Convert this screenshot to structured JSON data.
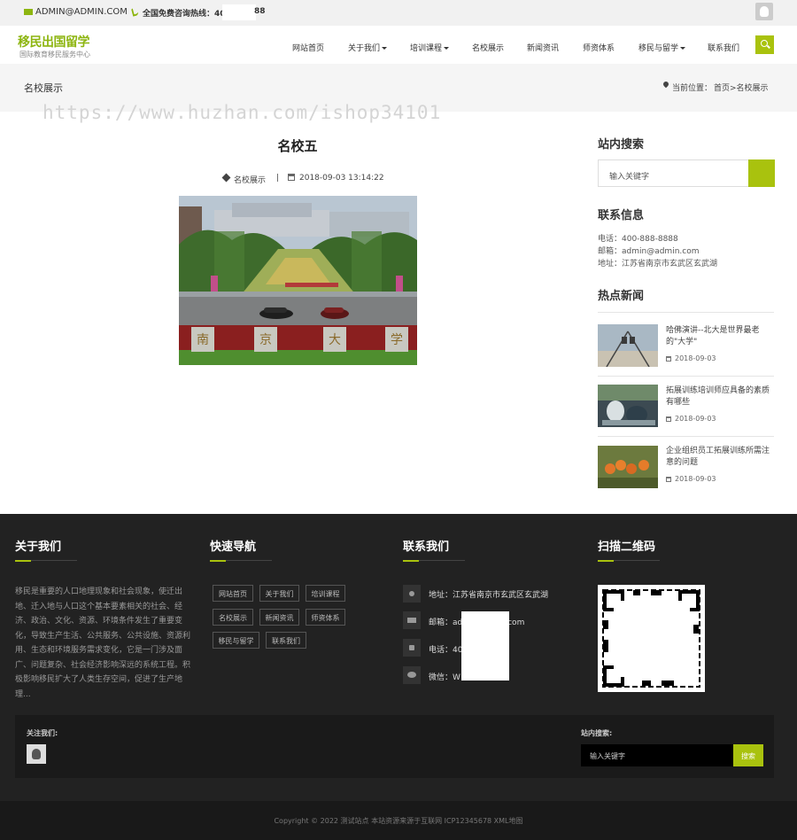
{
  "topbar": {
    "email": "ADMIN@ADMIN.COM",
    "hotline": "全国免费咨询热线：40",
    "hotline_tail": "88"
  },
  "header": {
    "logo_title": "移民出国留学",
    "logo_sub": "国际教育移民服务中心",
    "nav": [
      "网站首页",
      "关于我们",
      "培训课程",
      "名校展示",
      "新闻资讯",
      "师资体系",
      "移民与留学",
      "联系我们"
    ]
  },
  "band": {
    "title": "名校展示",
    "location_label": "当前位置：",
    "breadcrumb": "首页>名校展示"
  },
  "watermark": "https://www.huzhan.com/ishop34101",
  "article": {
    "title": "名校五",
    "category": "名校展示",
    "separator": "|",
    "datetime": "2018-09-03 13:14:22",
    "sign": [
      "南",
      "京",
      "大",
      "学"
    ]
  },
  "sidebar": {
    "search_title": "站内搜索",
    "search_placeholder": "输入关键字",
    "contact_title": "联系信息",
    "contact": [
      "电话：400-888-8888",
      "邮箱：admin@admin.com",
      "地址：江苏省南京市玄武区玄武湖"
    ],
    "hot_title": "热点新闻",
    "news": [
      {
        "title": "哈佛演讲--北大是世界最老的\"大学\"",
        "date": "2018-09-03"
      },
      {
        "title": "拓展训练培训师应具备的素质有哪些",
        "date": "2018-09-03"
      },
      {
        "title": "企业组织员工拓展训练所需注意的问题",
        "date": "2018-09-03"
      }
    ]
  },
  "footer": {
    "about_title": "关于我们",
    "about_text": "移民是重要的人口地理现象和社会现象，使迁出地、迁入地与人口这个基本要素相关的社会、经济、政治、文化、资源、环境条件发生了重要变化，导致生产生活、公共服务、公共设施、资源利用、生态和环境服务需求变化，它是一门涉及面广、问题复杂、社会经济影响深远的系统工程。积极影响移民扩大了人类生存空间，促进了生产地理...",
    "nav_title": "快速导航",
    "links": [
      "网站首页",
      "关于我们",
      "培训课程",
      "名校展示",
      "新闻资讯",
      "师资体系",
      "移民与留学",
      "联系我们"
    ],
    "contact_title": "联系我们",
    "address": "地址：江苏省南京市玄武区玄武湖",
    "email_label": "邮箱：",
    "email_a": "ad",
    "email_b": ".com",
    "phone_label": "电话：",
    "phone_v": "40",
    "wechat_label": "微信：",
    "wechat_v": "W",
    "qr_title": "扫描二维码",
    "follow_label": "关注我们:",
    "search_label": "站内搜索:",
    "search_placeholder": "输入关键字",
    "search_btn": "搜索",
    "copyright": "Copyright © 2022 测试站点 本站资源来源于互联网 ICP12345678 XML地图"
  },
  "colors": {
    "accent": "#a9c20e",
    "logo": "#8db510",
    "footer_bg": "#222222"
  }
}
